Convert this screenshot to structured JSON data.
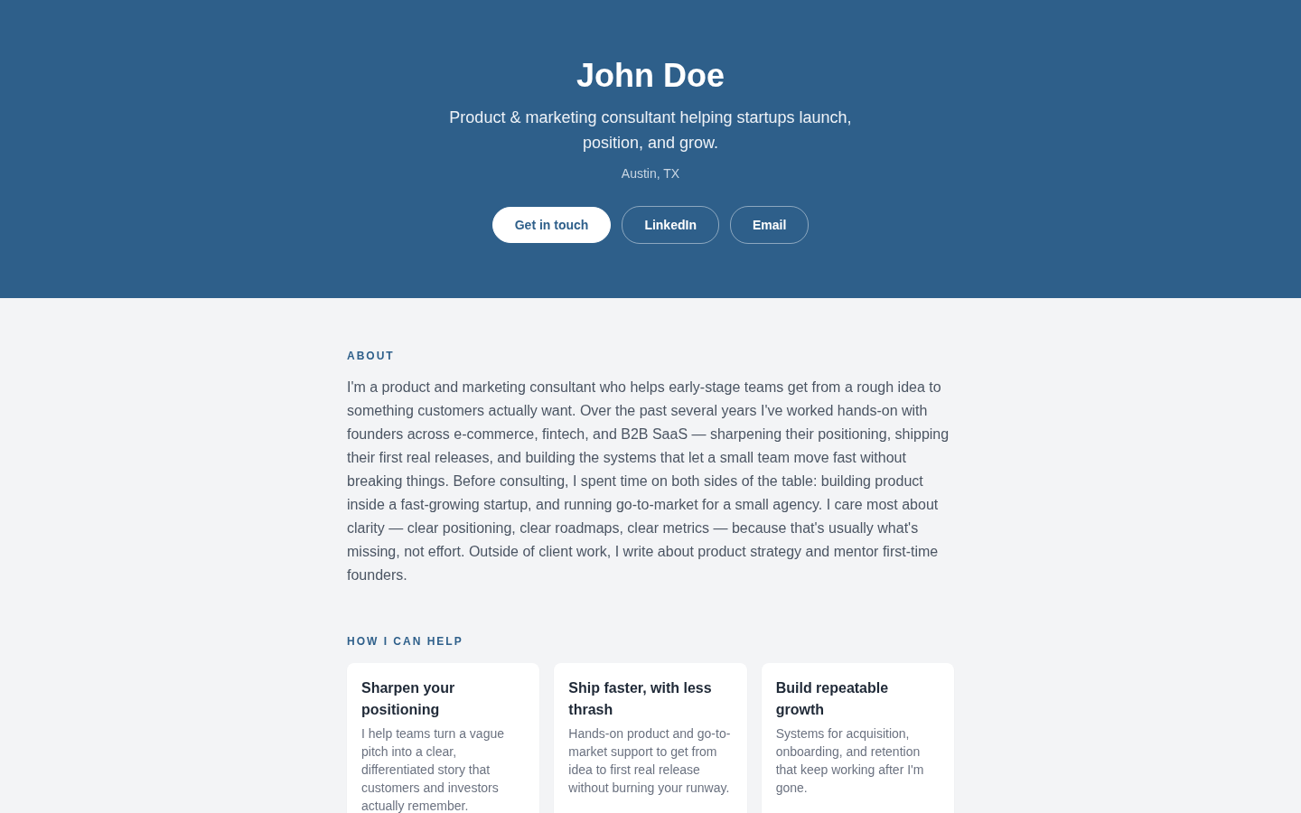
{
  "hero": {
    "name": "John Doe",
    "tagline": "Product & marketing consultant helping startups launch, position, and grow.",
    "location": "Austin, TX",
    "buttons": [
      {
        "label": "Get in touch",
        "kind": "primary"
      },
      {
        "label": "LinkedIn",
        "kind": "outline"
      },
      {
        "label": "Email",
        "kind": "outline"
      }
    ]
  },
  "about": {
    "heading": "ABOUT",
    "text": "I'm a product and marketing consultant who helps early-stage teams get from a rough idea to something customers actually want. Over the past several years I've worked hands-on with founders across e-commerce, fintech, and B2B SaaS — sharpening their positioning, shipping their first real releases, and building the systems that let a small team move fast without breaking things. Before consulting, I spent time on both sides of the table: building product inside a fast-growing startup, and running go-to-market for a small agency. I care most about clarity — clear positioning, clear roadmaps, clear metrics — because that's usually what's missing, not effort. Outside of client work, I write about product strategy and mentor first-time founders."
  },
  "services": {
    "heading": "HOW I CAN HELP",
    "cards": [
      {
        "title": "Sharpen your positioning",
        "text": "I help teams turn a vague pitch into a clear, differentiated story that customers and investors actually remember."
      },
      {
        "title": "Ship faster, with less thrash",
        "text": "Hands-on product and go-to-market support to get from idea to first real release without burning your runway."
      },
      {
        "title": "Build repeatable growth",
        "text": "Systems for acquisition, onboarding, and retention that keep working after I'm gone."
      }
    ]
  }
}
